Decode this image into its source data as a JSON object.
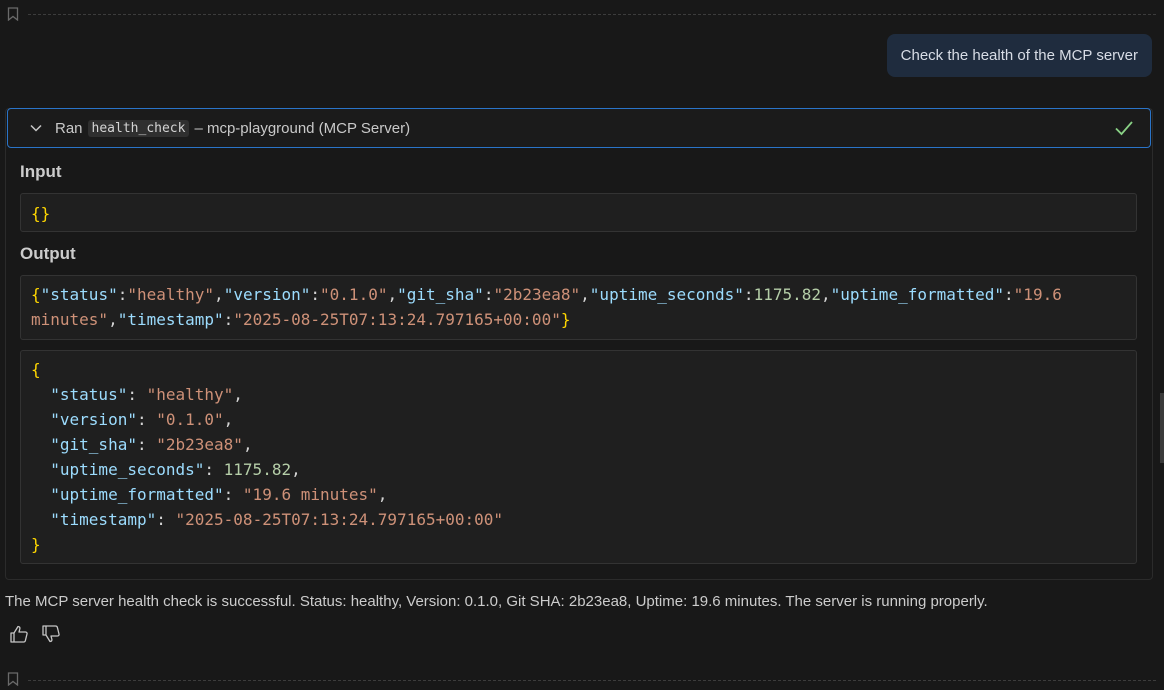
{
  "user_message": "Check the health of the MCP server",
  "tool_call": {
    "prefix": "Ran",
    "tool_name": "health_check",
    "suffix": "– mcp-playground (MCP Server)"
  },
  "input": {
    "label": "Input",
    "value": "{}"
  },
  "output": {
    "label": "Output",
    "raw_line1": {
      "status_key": "\"status\"",
      "status_val": "\"healthy\"",
      "version_key": "\"version\"",
      "version_val": "\"0.1.0\"",
      "git_key": "\"git_sha\"",
      "git_val": "\"2b23ea8\"",
      "uptime_key": "\"uptime_seconds\"",
      "uptime_val": "1175.82",
      "fmt_key": "\"uptime_formatted\"",
      "fmt_val_start": "\"19.6"
    },
    "raw_line2": {
      "fmt_val_end": "minutes\"",
      "ts_key": "\"timestamp\"",
      "ts_val": "\"2025-08-25T07:13:24.797165+00:00\""
    },
    "pretty": [
      {
        "key": "\"status\"",
        "value": "\"healthy\"",
        "type": "str"
      },
      {
        "key": "\"version\"",
        "value": "\"0.1.0\"",
        "type": "str"
      },
      {
        "key": "\"git_sha\"",
        "value": "\"2b23ea8\"",
        "type": "str"
      },
      {
        "key": "\"uptime_seconds\"",
        "value": "1175.82",
        "type": "num"
      },
      {
        "key": "\"uptime_formatted\"",
        "value": "\"19.6 minutes\"",
        "type": "str"
      },
      {
        "key": "\"timestamp\"",
        "value": "\"2025-08-25T07:13:24.797165+00:00\"",
        "type": "str"
      }
    ]
  },
  "assistant_summary": "The MCP server health check is successful. Status: healthy, Version: 0.1.0, Git SHA: 2b23ea8, Uptime: 19.6 minutes. The server is running properly.",
  "icons": {
    "bookmark": "bookmark-icon",
    "chevron": "chevron-down-icon",
    "check": "checkmark-icon",
    "thumbs_up": "thumbs-up-icon",
    "thumbs_down": "thumbs-down-icon"
  },
  "colors": {
    "accent_border": "#2a74c8",
    "success": "#89d185",
    "json_key": "#9cdcfe",
    "json_string": "#ce9178",
    "json_number": "#b5cea8",
    "json_brace": "#ffd700"
  }
}
